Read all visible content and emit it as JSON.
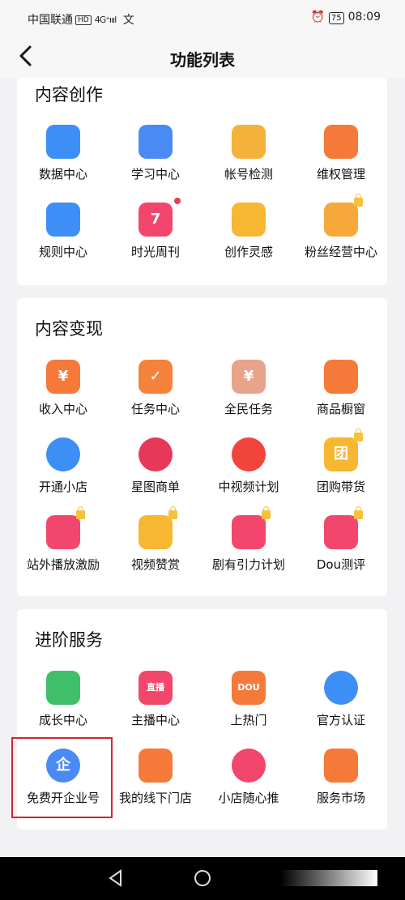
{
  "status_bar": {
    "carrier": "中国联通",
    "hd": "HD",
    "signal": "4G⁺ıııl",
    "extra": "文",
    "battery": "75",
    "time": "08:09"
  },
  "nav": {
    "title": "功能列表"
  },
  "sections": [
    {
      "title": "内容创作",
      "items": [
        {
          "label": "数据中心",
          "icon": "chart-board-icon",
          "color": "#3d8ff5"
        },
        {
          "label": "学习中心",
          "icon": "graduation-cap-icon",
          "color": "#4a8af4"
        },
        {
          "label": "帐号检测",
          "icon": "user-search-icon",
          "color": "#f5b23a"
        },
        {
          "label": "维权管理",
          "icon": "umbrella-icon",
          "color": "#f57a3a"
        },
        {
          "label": "规则中心",
          "icon": "rule-book-icon",
          "color": "#3d8ff5"
        },
        {
          "label": "时光周刊",
          "icon": "calendar-icon",
          "color": "#f3466c",
          "badge": "7"
        },
        {
          "label": "创作灵感",
          "icon": "lightbulb-icon",
          "color": "#f7b733"
        },
        {
          "label": "粉丝经营中心",
          "icon": "heart-gear-icon",
          "color": "#f7a83a"
        }
      ]
    },
    {
      "title": "内容变现",
      "items": [
        {
          "label": "收入中心",
          "icon": "yuan-icon",
          "color": "#f57a3a",
          "glyph": "¥"
        },
        {
          "label": "任务中心",
          "icon": "task-calendar-icon",
          "color": "#f5823a",
          "glyph": "✓"
        },
        {
          "label": "全民任务",
          "icon": "yuan-cards-icon",
          "color": "#e8a38a",
          "glyph": "¥"
        },
        {
          "label": "商品橱窗",
          "icon": "shopping-cart-icon",
          "color": "#f57a3a"
        },
        {
          "label": "开通小店",
          "icon": "shop-icon",
          "color": "#3d8ff5"
        },
        {
          "label": "星图商单",
          "icon": "star-map-icon",
          "color": "#e8385a"
        },
        {
          "label": "中视频计划",
          "icon": "play-icon",
          "color": "#f0443c"
        },
        {
          "label": "团购带货",
          "icon": "group-buy-icon",
          "color": "#f7b733",
          "glyph": "团"
        },
        {
          "label": "站外播放激励",
          "icon": "play-reward-icon",
          "color": "#f3466c"
        },
        {
          "label": "视频赞赏",
          "icon": "music-coin-icon",
          "color": "#f7b733"
        },
        {
          "label": "剧有引力计划",
          "icon": "tv-reward-icon",
          "color": "#f3466c"
        },
        {
          "label": "Dou测评",
          "icon": "gift-icon",
          "color": "#f3466c"
        }
      ]
    },
    {
      "title": "进阶服务",
      "items": [
        {
          "label": "成长中心",
          "icon": "sprout-icon",
          "color": "#3fbf6a"
        },
        {
          "label": "主播中心",
          "icon": "live-camera-icon",
          "color": "#f3466c",
          "glyph": "直播"
        },
        {
          "label": "上热门",
          "icon": "dou-icon",
          "color": "#f57a3a",
          "glyph": "DOU"
        },
        {
          "label": "官方认证",
          "icon": "shield-check-icon",
          "color": "#3d8ff5"
        },
        {
          "label": "免费开企业号",
          "icon": "enterprise-icon",
          "color": "#4a8af4",
          "glyph": "企"
        },
        {
          "label": "我的线下门店",
          "icon": "storefront-icon",
          "color": "#f57a3a"
        },
        {
          "label": "小店随心推",
          "icon": "boost-icon",
          "color": "#f3466c"
        },
        {
          "label": "服务市场",
          "icon": "service-market-icon",
          "color": "#f57a3a"
        }
      ]
    }
  ]
}
